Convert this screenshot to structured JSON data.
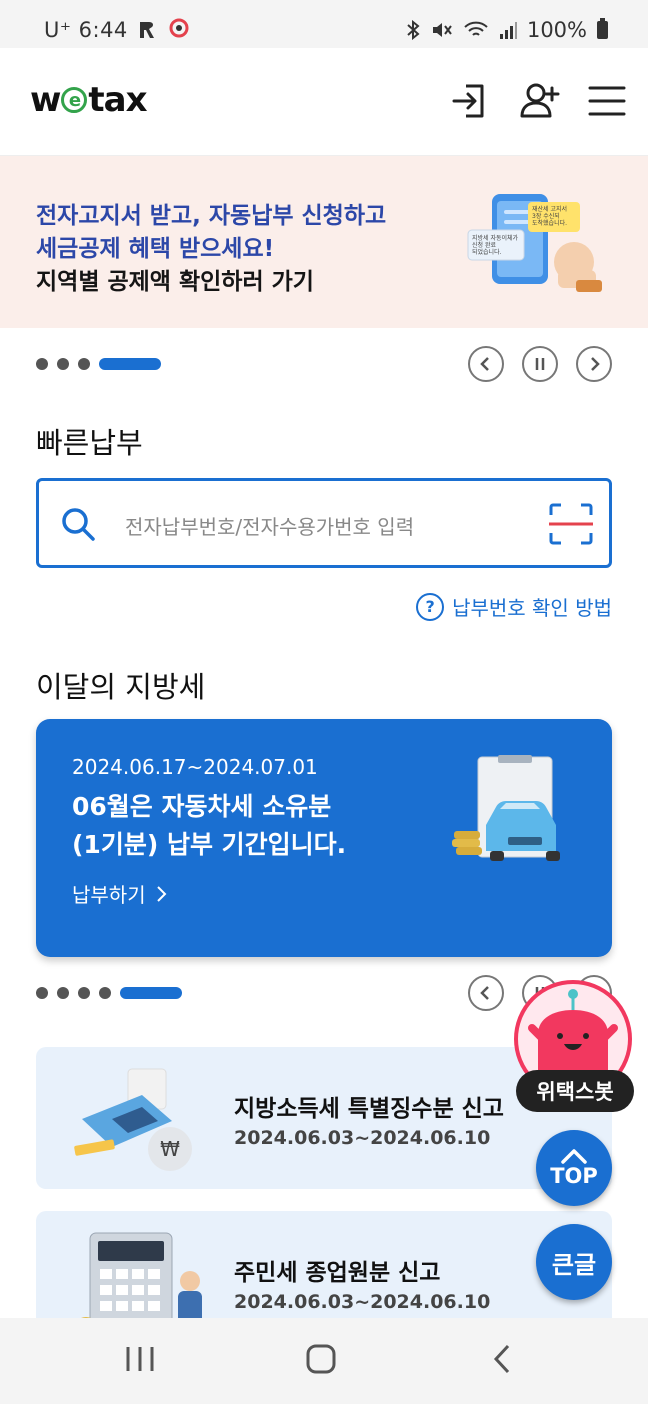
{
  "status_bar": {
    "carrier": "U⁺ 6:44",
    "battery": "100%"
  },
  "header": {
    "logo_prefix": "w",
    "logo_e": "e",
    "logo_suffix": "tax",
    "icons": [
      "login-icon",
      "add-user-icon",
      "menu-icon"
    ]
  },
  "banner": {
    "line1": "전자고지서 받고, 자동납부 신청하고",
    "line2": "세금공제 혜택 받으세요!",
    "line3": "지역별 공제액 확인하러 가기",
    "illustration_text": {
      "bubble1": "재산세 고지서\n3장 수신되\n도착했습니다.",
      "bubble2": "지방세 자동이체가\n신청 완료\n되었습니다."
    },
    "pages": 4,
    "active_page": 4
  },
  "quick_pay": {
    "title": "빠른납부",
    "placeholder": "전자납부번호/전자수용가번호 입력",
    "help_link": "납부번호 확인 방법"
  },
  "monthly_tax": {
    "title": "이달의 지방세",
    "card": {
      "period": "2024.06.17~2024.07.01",
      "message_line1": "06월은 자동차세 소유분",
      "message_line2": "(1기분) 납부 기간입니다.",
      "link": "납부하기"
    },
    "pages": 5,
    "active_page": 5
  },
  "schedule": [
    {
      "title": "지방소득세 특별징수분 신고",
      "date": "2024.06.03~2024.06.10"
    },
    {
      "title": "주민세 종업원분 신고",
      "date": "2024.06.03~2024.06.10"
    }
  ],
  "floating": {
    "bot_label": "위택스봇",
    "top_label": "TOP",
    "bigtext_label": "큰글"
  },
  "colors": {
    "primary": "#1a6fd1",
    "banner_bg": "#fbeeea",
    "banner_accent": "#2c47a8",
    "list_bg": "#e8f1fb",
    "logo_green": "#33a34b"
  }
}
